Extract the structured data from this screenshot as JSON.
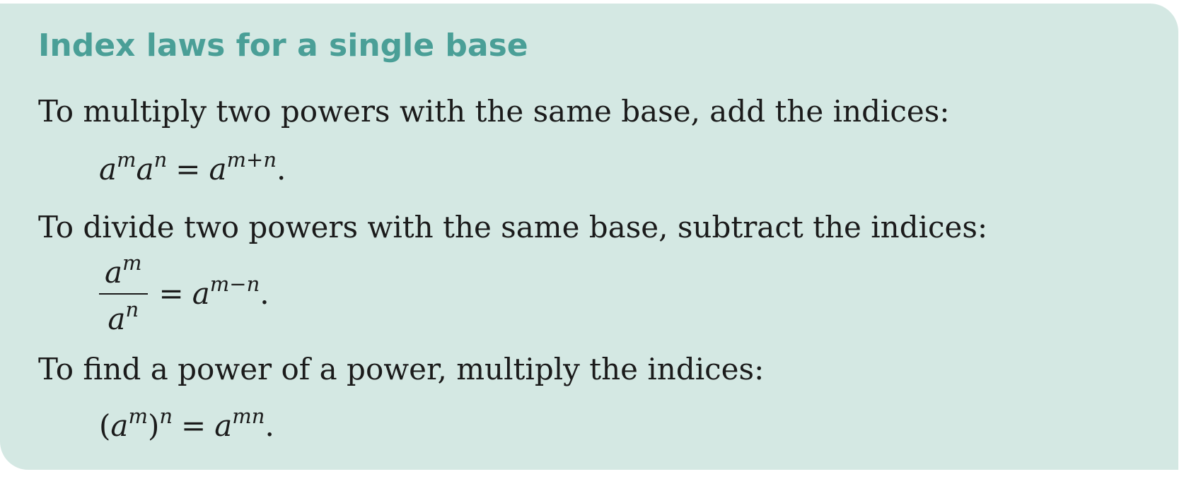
{
  "title": "Index laws for a single base",
  "rules": [
    {
      "statement": "To multiply two powers with the same base, add the indices:",
      "formula": {
        "base": "a",
        "m": "m",
        "n": "n",
        "op": "=",
        "result_exp": "m+n",
        "end": "."
      }
    },
    {
      "statement": "To divide two powers with the same base, subtract the indices:",
      "formula": {
        "base": "a",
        "m": "m",
        "n": "n",
        "op": "=",
        "result_exp": "m−n",
        "end": "."
      }
    },
    {
      "statement": "To find a power of a power, multiply the indices:",
      "formula": {
        "base": "a",
        "m": "m",
        "n": "n",
        "lparen": "(",
        "rparen": ")",
        "op": "=",
        "result_exp": "mn",
        "end": "."
      }
    }
  ],
  "colors": {
    "box_background": "#d4e8e3",
    "title": "#4a9f97",
    "text": "#1b1b1b"
  }
}
